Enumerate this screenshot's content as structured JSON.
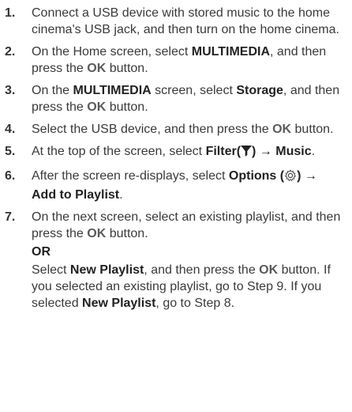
{
  "steps": [
    {
      "num": "1.",
      "text": "Connect a USB device with stored music to the home cinema's USB jack, and then turn on the home cinema."
    },
    {
      "num": "2.",
      "a": "On the Home screen, select ",
      "b": "MULTIMEDIA",
      "c": ", and then press the ",
      "ok": "OK",
      "d": " button."
    },
    {
      "num": "3.",
      "a": "On the ",
      "b": "MULTIMEDIA",
      "c": " screen, select ",
      "b2": "Storage",
      "d": ", and then press the ",
      "ok": "OK",
      "e": " button."
    },
    {
      "num": "4.",
      "a": "Select the USB device, and then press the ",
      "ok": "OK",
      "b": " button."
    },
    {
      "num": "5.",
      "a": "At the top of the screen, select ",
      "b": "Filter(",
      "icon": "filter-icon",
      "c": ") → Music",
      "d": "."
    },
    {
      "num": "6.",
      "a": "After the screen re-displays, select ",
      "b": "Options (",
      "icon": "gear-icon",
      "c": ") → Add to Playlist",
      "d": "."
    },
    {
      "num": "7.",
      "a": "On the next screen, select an existing playlist, and then press the ",
      "ok": "OK",
      "b": " button.",
      "or": "OR",
      "c": "Select ",
      "d": "New Playlist",
      "e": ", and then press the ",
      "ok2": "OK",
      "f": " button. If you selected an existing playlist, go to Step 9. If you selected ",
      "g": "New Playlist",
      "h": ", go to Step 8."
    }
  ]
}
